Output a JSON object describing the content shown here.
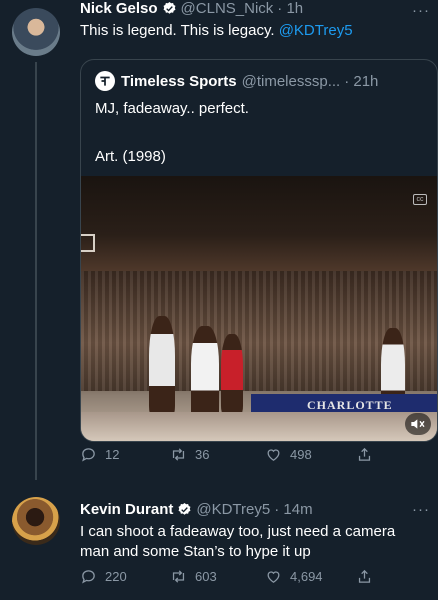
{
  "colors": {
    "background": "#15202b",
    "accent": "#1d9bf0",
    "muted": "#8b98a5",
    "border": "#38444d"
  },
  "tweet1": {
    "name": "Nick Gelso",
    "handle": "@CLNS_Nick",
    "time": "· 1h",
    "text": "This is legend. This is legacy.",
    "mention": "@KDTrey5",
    "more": "···"
  },
  "quote": {
    "name": "Timeless Sports",
    "handle": "@timelesssp...",
    "time": "· 21h",
    "line1": "MJ, fadeaway.. perfect.",
    "line2": "Art. (1998)",
    "banner": "CHARLOTTE"
  },
  "tweet1_actions": {
    "reply": "12",
    "retweet": "36",
    "like": "498"
  },
  "tweet2": {
    "name": "Kevin Durant",
    "handle": "@KDTrey5",
    "time": "· 14m",
    "text": "I can shoot a fadeaway too, just need a camera man and some Stan’s to hype it up",
    "more": "···"
  },
  "tweet2_actions": {
    "reply": "220",
    "retweet": "603",
    "like": "4,694"
  }
}
